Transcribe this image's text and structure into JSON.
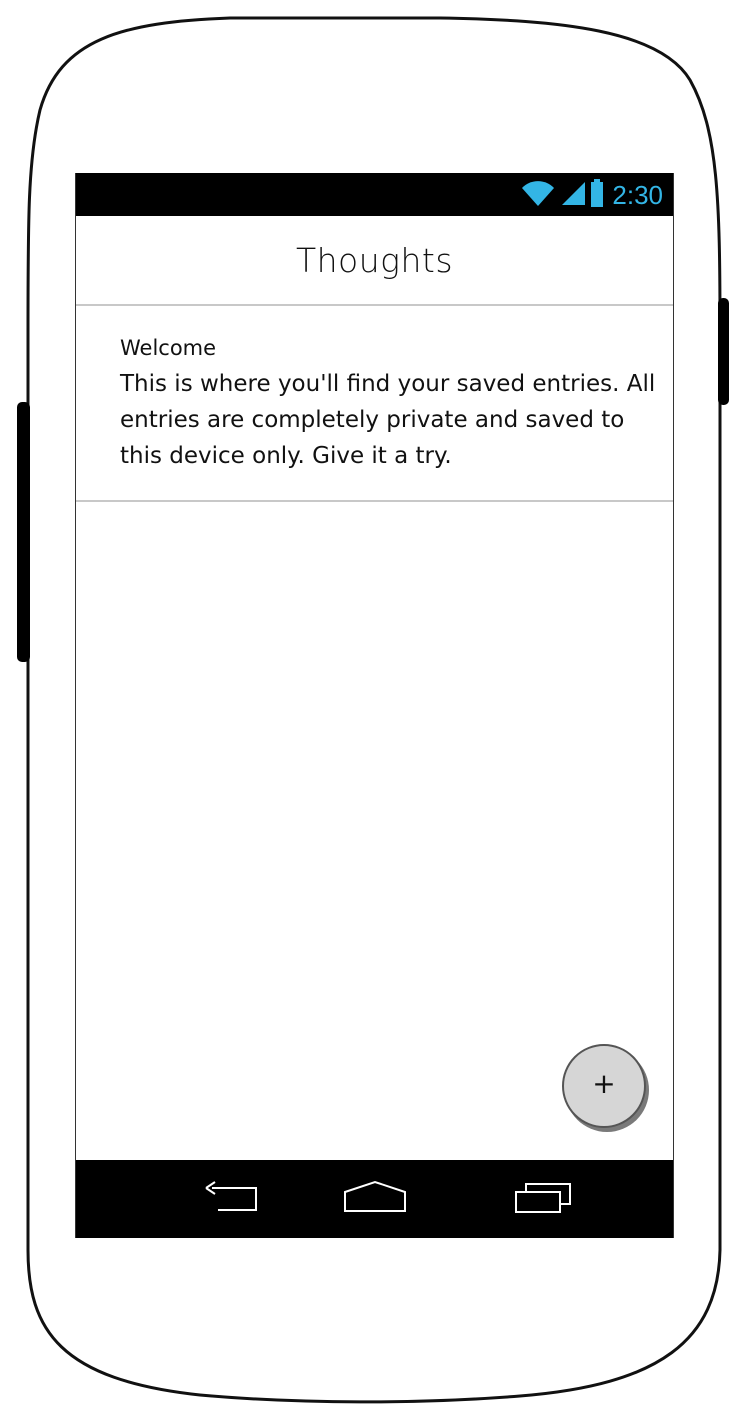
{
  "status_bar": {
    "time": "2:30",
    "icons": [
      "wifi-icon",
      "signal-icon",
      "battery-icon"
    ],
    "accent_color": "#33b5e5"
  },
  "app_bar": {
    "title": "Thoughts"
  },
  "entries": [
    {
      "title": "Welcome",
      "body": "This is where you'll find your saved entries. All entries are completely private and saved to this device only. Give it a try."
    }
  ],
  "fab": {
    "label": "+",
    "icon": "add-icon"
  },
  "nav_bar": {
    "buttons": [
      "back-icon",
      "home-icon",
      "recents-icon"
    ]
  }
}
